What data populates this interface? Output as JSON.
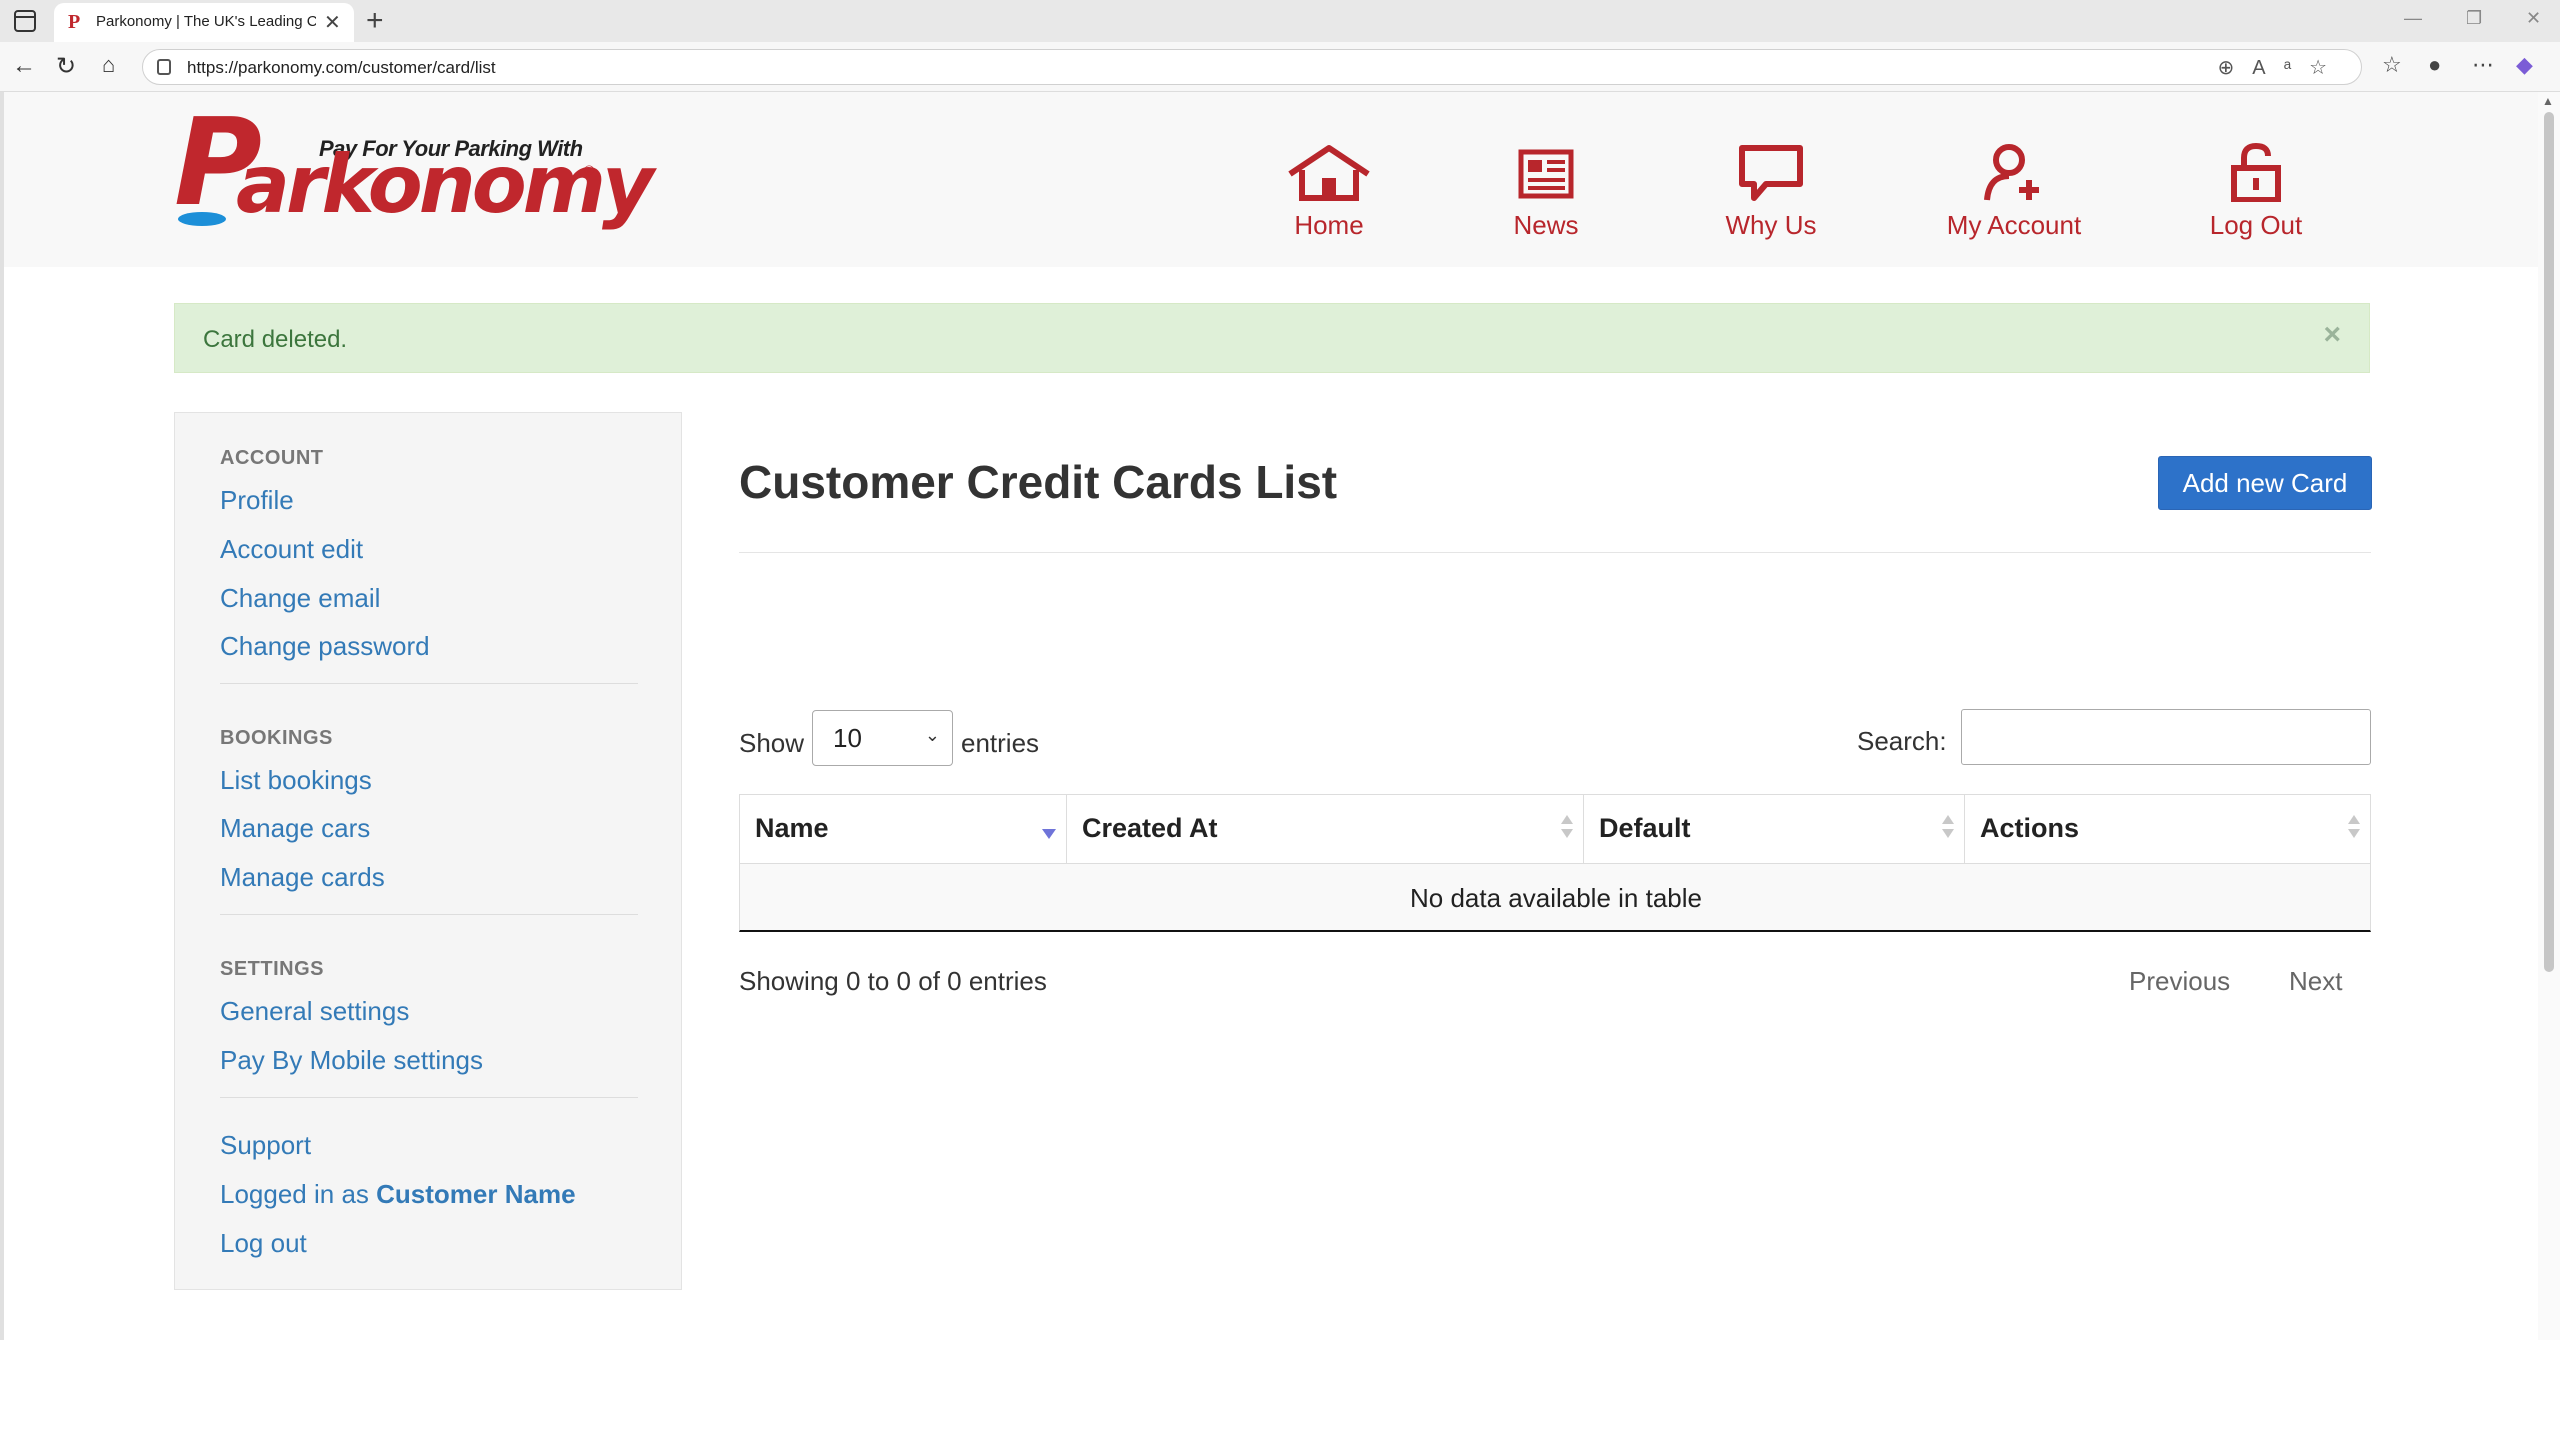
{
  "browser": {
    "tab_title": "Parkonomy | The UK's Leading Ca",
    "url": "https://parkonomy.com/customer/card/list",
    "new_tab_symbol": "+",
    "tab_close_symbol": "✕"
  },
  "logo": {
    "tagline": "Pay For Your Parking With",
    "brand_first": "P",
    "brand_rest": "arkonomy",
    "registered": "®"
  },
  "nav": {
    "items": [
      {
        "label": "Home",
        "icon": "house-icon"
      },
      {
        "label": "News",
        "icon": "newspaper-icon"
      },
      {
        "label": "Why Us",
        "icon": "speech-bubble-icon"
      },
      {
        "label": "My Account",
        "icon": "user-plus-icon"
      },
      {
        "label": "Log Out",
        "icon": "unlock-icon"
      }
    ],
    "color": "#b8262c"
  },
  "alert": {
    "message": "Card deleted.",
    "close": "×"
  },
  "sidebar": {
    "account_heading": "ACCOUNT",
    "account_links": [
      "Profile",
      "Account edit",
      "Change email",
      "Change password"
    ],
    "bookings_heading": "BOOKINGS",
    "bookings_links": [
      "List bookings",
      "Manage cars",
      "Manage cards"
    ],
    "settings_heading": "SETTINGS",
    "settings_links": [
      "General settings",
      "Pay By Mobile settings"
    ],
    "support": "Support",
    "logged_in_prefix": "Logged in as ",
    "logged_in_user": "Customer Name",
    "logout": "Log out"
  },
  "main": {
    "title": "Customer Credit Cards List",
    "add_button": "Add new Card",
    "show_label": "Show",
    "page_length": "10",
    "entries_label": "entries",
    "search_label": "Search:",
    "search_value": "",
    "columns": [
      "Name",
      "Created At",
      "Default",
      "Actions"
    ],
    "empty_message": "No data available in table",
    "info": "Showing 0 to 0 of 0 entries",
    "previous": "Previous",
    "next": "Next"
  },
  "colors": {
    "brand_red": "#c0272d",
    "link_blue": "#337ab7",
    "button_blue": "#2d72c9",
    "alert_green_bg": "#dff0d8",
    "alert_green_text": "#3c763d"
  }
}
